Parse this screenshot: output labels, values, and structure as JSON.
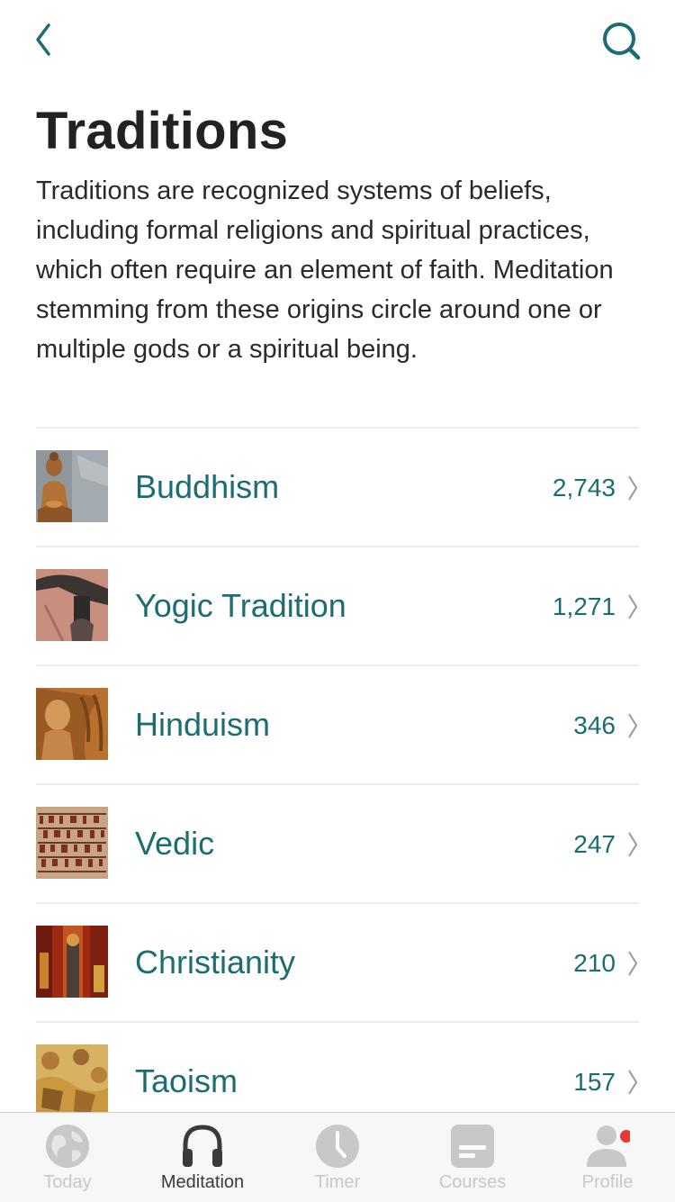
{
  "header": {
    "back_icon": "chevron-left-icon",
    "search_icon": "search-icon",
    "title": "Traditions",
    "description": "Traditions are recognized systems of beliefs, including formal religions and spiritual practices, which often require an element of faith. Meditation stemming from these origins circle around one or multiple gods or a spiritual being."
  },
  "colors": {
    "accent": "#1c6c73",
    "title": "#222222",
    "tab_inactive": "#c8c8c8",
    "tab_active": "#3a3a3a",
    "notification_dot": "#e53935"
  },
  "traditions": [
    {
      "label": "Buddhism",
      "count": "2,743",
      "icon": "buddha-statue-thumbnail"
    },
    {
      "label": "Yogic Tradition",
      "count": "1,271",
      "icon": "yoga-pose-thumbnail"
    },
    {
      "label": "Hinduism",
      "count": "346",
      "icon": "hindu-carving-thumbnail"
    },
    {
      "label": "Vedic",
      "count": "247",
      "icon": "sanskrit-script-thumbnail"
    },
    {
      "label": "Christianity",
      "count": "210",
      "icon": "christian-painting-thumbnail"
    },
    {
      "label": "Taoism",
      "count": "157",
      "icon": "taoist-art-thumbnail"
    }
  ],
  "tabs": [
    {
      "label": "Today",
      "icon": "globe-icon",
      "active": false
    },
    {
      "label": "Meditation",
      "icon": "headphones-icon",
      "active": true
    },
    {
      "label": "Timer",
      "icon": "clock-icon",
      "active": false
    },
    {
      "label": "Courses",
      "icon": "courses-icon",
      "active": false
    },
    {
      "label": "Profile",
      "icon": "profile-icon",
      "active": false,
      "badge": true
    }
  ]
}
